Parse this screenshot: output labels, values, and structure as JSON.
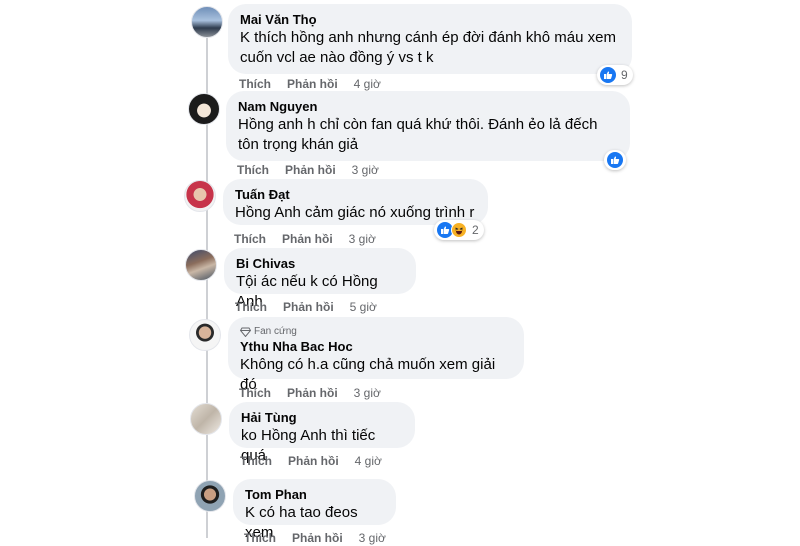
{
  "comments": [
    {
      "author": "Mai Văn Thọ",
      "line1": "K thích hồng anh nhưng cánh ép đời đánh khô máu xem",
      "line2": "cuốn vcl ae nào đồng ý vs t k",
      "like": "Thích",
      "reply": "Phản hồi",
      "time": "4 giờ",
      "reaction_count": "9"
    },
    {
      "author": "Nam Nguyen",
      "line1": "Hồng anh h chỉ còn fan quá khứ thôi. Đánh ẻo lả đếch",
      "line2": "tôn trọng khán giả",
      "like": "Thích",
      "reply": "Phản hồi",
      "time": "3 giờ"
    },
    {
      "author": "Tuấn Đạt",
      "line1": "Hồng Anh cảm giác nó xuống trình r",
      "like": "Thích",
      "reply": "Phản hồi",
      "time": "3 giờ",
      "reaction_count": "2"
    },
    {
      "author": "Bi Chivas",
      "line1": "Tội ác nếu k có Hồng Anh",
      "like": "Thích",
      "reply": "Phản hồi",
      "time": "5 giờ"
    },
    {
      "badge": "Fan cứng",
      "author": "Ythu Nha Bac Hoc",
      "line1": "Không có h.a cũng chả muốn xem giải đó",
      "like": "Thích",
      "reply": "Phản hồi",
      "time": "3 giờ"
    },
    {
      "author": "Hải Tùng",
      "line1": "ko Hồng Anh thì tiếc quá",
      "like": "Thích",
      "reply": "Phản hồi",
      "time": "4 giờ"
    },
    {
      "author": "Tom Phan",
      "line1": "K có ha tao đeos xem",
      "like": "Thích",
      "reply": "Phản hồi",
      "time": "3 giờ"
    }
  ],
  "colors": {
    "bubble": "#f0f2f5",
    "like_blue": "#1877f2",
    "meta_gray": "#65676b"
  },
  "icons": {
    "like": "thumbs-up-icon",
    "haha": "haha-face-icon",
    "badge": "diamond-icon"
  }
}
